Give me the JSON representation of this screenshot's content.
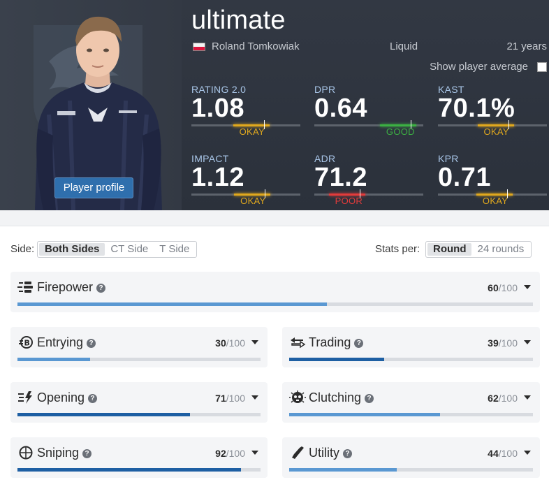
{
  "player": {
    "nickname": "ultimate",
    "real_name": "Roland Tomkowiak",
    "country": "Poland",
    "team": "Liquid",
    "age": "21 years",
    "profile_button": "Player profile",
    "show_average_label": "Show player average",
    "show_average_checked": false
  },
  "stats": [
    {
      "label": "RATING 2.0",
      "value": "1.08",
      "rating": "OKAY",
      "rating_color": "#e0a81e",
      "level": 0.55
    },
    {
      "label": "DPR",
      "value": "0.64",
      "rating": "GOOD",
      "rating_color": "#3cb043",
      "level": 0.77
    },
    {
      "label": "KAST",
      "value": "70.1%",
      "rating": "OKAY",
      "rating_color": "#e0a81e",
      "level": 0.53
    },
    {
      "label": "IMPACT",
      "value": "1.12",
      "rating": "OKAY",
      "rating_color": "#e0a81e",
      "level": 0.56
    },
    {
      "label": "ADR",
      "value": "71.2",
      "rating": "POOR",
      "rating_color": "#e23b3b",
      "level": 0.3
    },
    {
      "label": "KPR",
      "value": "0.71",
      "rating": "OKAY",
      "rating_color": "#e0a81e",
      "level": 0.52
    }
  ],
  "filters": {
    "side_label": "Side:",
    "side_options": [
      "Both Sides",
      "CT Side",
      "T Side"
    ],
    "side_selected": "Both Sides",
    "stats_per_label": "Stats per:",
    "stats_per_options": [
      "Round",
      "24 rounds"
    ],
    "stats_per_selected": "Round"
  },
  "categories": [
    {
      "name": "Firepower",
      "score": "60",
      "max": "/100",
      "fraction": 0.6,
      "icon": "firepower-icon"
    },
    {
      "name": "Entrying",
      "score": "30",
      "max": "/100",
      "fraction": 0.3,
      "icon": "entrying-icon"
    },
    {
      "name": "Trading",
      "score": "39",
      "max": "/100",
      "fraction": 0.39,
      "icon": "trading-icon"
    },
    {
      "name": "Opening",
      "score": "71",
      "max": "/100",
      "fraction": 0.71,
      "icon": "opening-icon"
    },
    {
      "name": "Clutching",
      "score": "62",
      "max": "/100",
      "fraction": 0.62,
      "icon": "clutching-icon"
    },
    {
      "name": "Sniping",
      "score": "92",
      "max": "/100",
      "fraction": 0.92,
      "icon": "sniping-icon"
    },
    {
      "name": "Utility",
      "score": "44",
      "max": "/100",
      "fraction": 0.44,
      "icon": "utility-icon"
    }
  ],
  "colors": {
    "accent": "#2f6fad",
    "bar_light": "#5a98d2",
    "bar_dark": "#1e5fa3",
    "header_bg": "#2e343e",
    "okay": "#e0a81e",
    "good": "#3cb043",
    "poor": "#e23b3b"
  }
}
